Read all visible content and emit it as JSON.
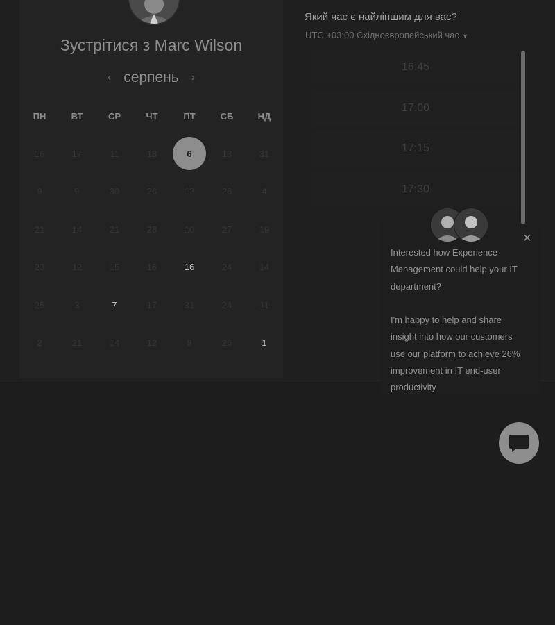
{
  "calendar": {
    "title": "Зустрітися з Marc Wilson",
    "month": "серпень",
    "weekdays": [
      "ПН",
      "ВТ",
      "СР",
      "ЧТ",
      "ПТ",
      "СБ",
      "НД"
    ],
    "days": [
      [
        "16",
        "17",
        "11",
        "18",
        "6",
        "13",
        "31"
      ],
      [
        "9",
        "9",
        "30",
        "26",
        "12",
        "26",
        "4"
      ],
      [
        "21",
        "14",
        "21",
        "28",
        "10",
        "27",
        "19"
      ],
      [
        "23",
        "12",
        "15",
        "16",
        "16",
        "24",
        "14"
      ],
      [
        "25",
        "3",
        "7",
        "17",
        "31",
        "24",
        "11"
      ],
      [
        "2",
        "21",
        "14",
        "12",
        "9",
        "26",
        "1"
      ]
    ],
    "available": [
      "0-4",
      "3-4",
      "4-2",
      "5-6"
    ],
    "selected": "0-4"
  },
  "time": {
    "question": "Який час є найліпшим для вас?",
    "timezone": "UTC +03:00 Східноєвропейський час",
    "slots": [
      "16:45",
      "17:00",
      "17:15",
      "17:30"
    ]
  },
  "popup": {
    "message1": "Interested how Experience Management could help your IT department?",
    "message2": "I'm happy to help and share insight into how our customers use our platform to achieve 26% improvement in IT end-user productivity"
  },
  "icons": {
    "prev": "chevron-left-icon",
    "next": "chevron-right-icon",
    "tz_dropdown": "caret-down-icon",
    "close": "close-icon",
    "chat": "chat-bubble-icon"
  }
}
